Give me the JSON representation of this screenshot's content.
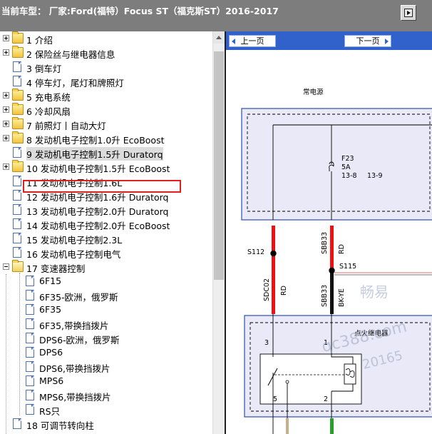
{
  "window": {
    "title": "当前车型： 厂家:Ford(福特）Focus ST（福克斯ST）2016-2017"
  },
  "tree": {
    "items": [
      {
        "label": "1 介绍",
        "type": "folder",
        "expander": "plus"
      },
      {
        "label": "2 保险丝与继电器信息",
        "type": "folder",
        "expander": "plus"
      },
      {
        "label": "3 倒车灯",
        "type": "doc"
      },
      {
        "label": "4 停车灯，尾灯和牌照灯",
        "type": "doc"
      },
      {
        "label": "5 充电系统",
        "type": "folder",
        "expander": "plus"
      },
      {
        "label": "6 冷却风扇",
        "type": "folder",
        "expander": "plus"
      },
      {
        "label": "7 前照灯丨自动大灯",
        "type": "folder",
        "expander": "plus"
      },
      {
        "label": "8 发动机电子控制1.0升 EcoBoost",
        "type": "folder",
        "expander": "plus"
      },
      {
        "label": "9 发动机电子控制1.5升 Duratorq",
        "type": "doc",
        "selected": true
      },
      {
        "label": "10 发动机电子控制1.5升 EcoBoost",
        "type": "folder",
        "expander": "plus"
      },
      {
        "label": "11 发动机电子控制1.6L",
        "type": "doc"
      },
      {
        "label": "12 发动机电子控制1.6升 Duratorq",
        "type": "doc"
      },
      {
        "label": "13 发动机电子控制2.0升 Duratorq",
        "type": "doc"
      },
      {
        "label": "14 发动机电子控制2.0升 EcoBoost",
        "type": "doc"
      },
      {
        "label": "15 发动机电子控制2.3L",
        "type": "doc"
      },
      {
        "label": "16 发动机电子控制电气",
        "type": "doc"
      },
      {
        "label": "17 变速器控制",
        "type": "folder-open",
        "expander": "minus"
      },
      {
        "label": "6F15",
        "type": "doc",
        "indent": 1
      },
      {
        "label": "6F35-欧洲，俄罗斯",
        "type": "doc",
        "indent": 1
      },
      {
        "label": "6F35",
        "type": "doc",
        "indent": 1
      },
      {
        "label": "6F35,带换挡拨片",
        "type": "doc",
        "indent": 1
      },
      {
        "label": "DPS6-欧洲，俄罗斯",
        "type": "doc",
        "indent": 1
      },
      {
        "label": "DPS6",
        "type": "doc",
        "indent": 1
      },
      {
        "label": "DPS6,带换挡拨片",
        "type": "doc",
        "indent": 1
      },
      {
        "label": "MPS6",
        "type": "doc",
        "indent": 1
      },
      {
        "label": "MPS6,带换挡拨片",
        "type": "doc",
        "indent": 1
      },
      {
        "label": "RS只",
        "type": "doc",
        "indent": 1
      },
      {
        "label": "18 可调节转向柱",
        "type": "doc"
      }
    ]
  },
  "viewer": {
    "prev_label": "上一页",
    "next_label": "下一页",
    "diagram": {
      "header_label": "常电源",
      "fuse": {
        "name": "F23",
        "rating": "5A",
        "pin_a": "13-8",
        "pin_b": "13-9"
      },
      "splice_left": "S112",
      "splice_right": "S115",
      "wire_left_top": "SDC02",
      "wire_left_color": "RD",
      "wire_right_top": "SBB33",
      "wire_right_top_color": "RD",
      "wire_right_bottom": "SBB33",
      "wire_right_bottom_color": "BK-YE",
      "relay_label": "点火继电器",
      "pins": [
        "3",
        "1",
        "5",
        "2"
      ],
      "colors": {
        "wire_red": "#ee1111",
        "wire_black": "#111111",
        "wire_green": "#2aa02a",
        "border_blue": "#2d4fb0",
        "fill_lavender": "#e9e9f7"
      }
    },
    "watermarks": [
      "畅易",
      "qc388.com",
      "20165"
    ]
  }
}
